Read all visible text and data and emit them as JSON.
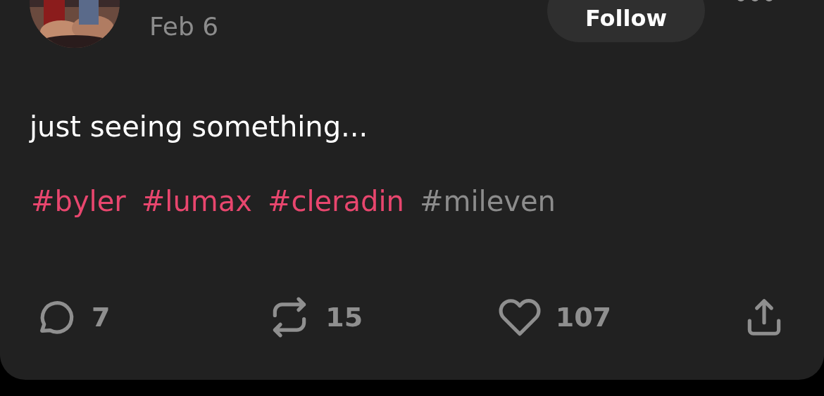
{
  "post": {
    "date": "Feb 6",
    "follow_label": "Follow",
    "text": "just seeing something...",
    "hashtags": [
      {
        "label": "#byler",
        "color": "#e8466e"
      },
      {
        "label": "#lumax",
        "color": "#e8466e"
      },
      {
        "label": "#cleradin",
        "color": "#e8466e"
      },
      {
        "label": "#mileven",
        "color": "#8c8c8c"
      }
    ],
    "actions": [
      {
        "kind": "comment",
        "count": "7"
      },
      {
        "kind": "repost",
        "count": "15"
      },
      {
        "kind": "like",
        "count": "107"
      },
      {
        "kind": "share"
      }
    ]
  }
}
